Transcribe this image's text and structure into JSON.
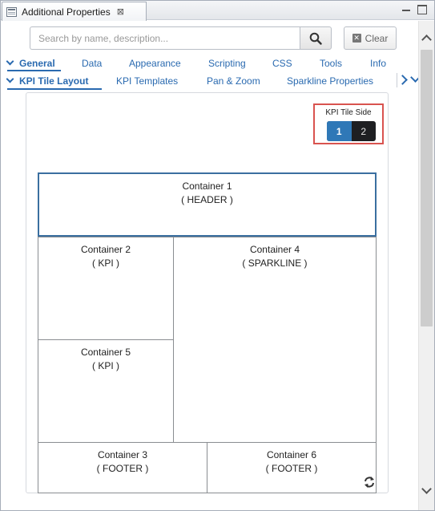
{
  "window": {
    "tab_title": "Additional Properties",
    "tab_icon": "properties-table-icon",
    "close_glyph": "⊠"
  },
  "search": {
    "placeholder": "Search by name, description...",
    "clear_label": "Clear"
  },
  "tabs_row1": [
    {
      "label": "General",
      "active": true
    },
    {
      "label": "Data",
      "active": false
    },
    {
      "label": "Appearance",
      "active": false
    },
    {
      "label": "Scripting",
      "active": false
    },
    {
      "label": "CSS",
      "active": false
    },
    {
      "label": "Tools",
      "active": false
    },
    {
      "label": "Info",
      "active": false
    }
  ],
  "tabs_row2": [
    {
      "label": "KPI Tile Layout",
      "active": true
    },
    {
      "label": "KPI Templates",
      "active": false
    },
    {
      "label": "Pan & Zoom",
      "active": false
    },
    {
      "label": "Sparkline Properties",
      "active": false
    }
  ],
  "kpi_tile_side": {
    "label": "KPI Tile Side",
    "options": [
      "1",
      "2"
    ],
    "selected": "1"
  },
  "containers": [
    {
      "name": "Container 1",
      "role": "( HEADER )"
    },
    {
      "name": "Container 2",
      "role": "( KPI )"
    },
    {
      "name": "Container 4",
      "role": "( SPARKLINE )"
    },
    {
      "name": "Container 5",
      "role": "( KPI )"
    },
    {
      "name": "Container 3",
      "role": "( FOOTER )"
    },
    {
      "name": "Container 6",
      "role": "( FOOTER )"
    }
  ],
  "colors": {
    "accent": "#2a6ab0",
    "highlight_border": "#d9534f",
    "selected_option": "#2f78b7",
    "toggle_bg": "#1e1f22"
  }
}
